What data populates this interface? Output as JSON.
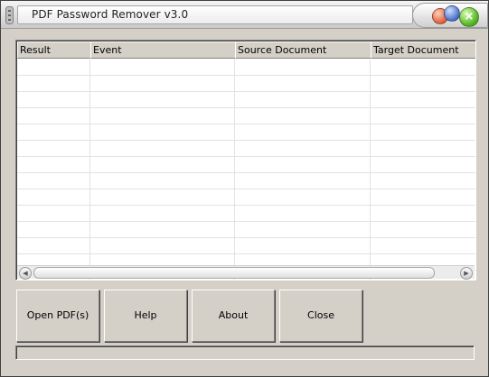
{
  "window": {
    "title": "PDF Password Remover v3.0"
  },
  "titlebar_buttons": {
    "minimize_icon": "orange-orb-icon",
    "maximize_icon": "blue-orb-icon",
    "close_icon": "green-close-orb-icon",
    "close_glyph": "×"
  },
  "table": {
    "columns": [
      "Result",
      "Event",
      "Source Document",
      "Target Document"
    ],
    "row_count_visible": 14,
    "rows": []
  },
  "buttons": {
    "open": "Open PDF(s)",
    "help": "Help",
    "about": "About",
    "close": "Close"
  },
  "statusbar": {
    "text": ""
  },
  "scrollbar": {
    "left_arrow": "◀",
    "right_arrow": "▶"
  }
}
